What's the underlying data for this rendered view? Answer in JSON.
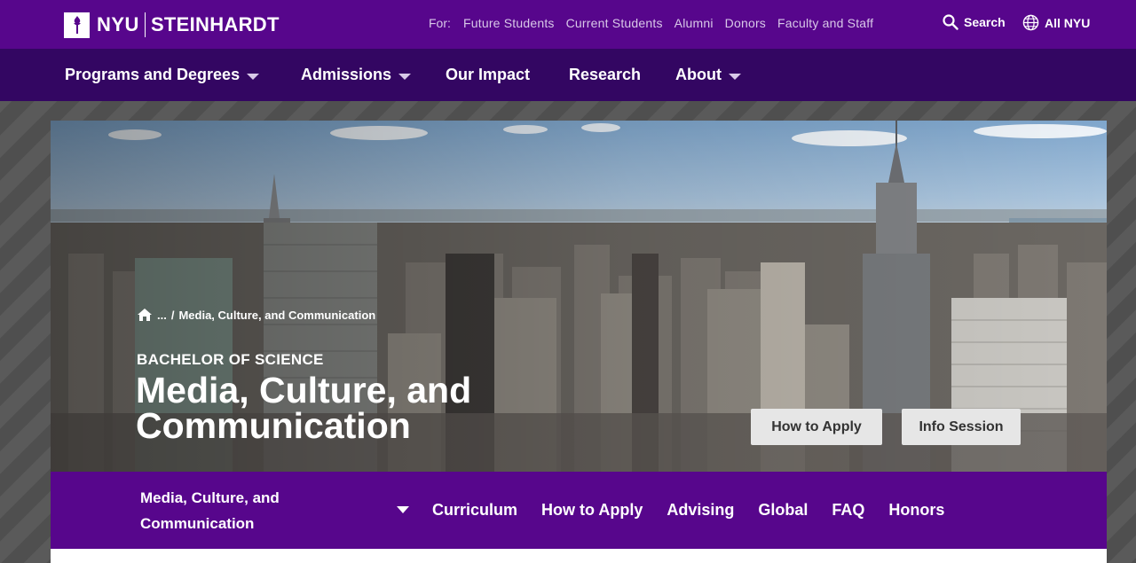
{
  "header": {
    "logo_nyu": "NYU",
    "logo_school": "STEINHARDT",
    "for_label": "For:",
    "utility_links": [
      "Future Students",
      "Current Students",
      "Alumni",
      "Donors",
      "Faculty and Staff"
    ],
    "search_label": "Search",
    "all_nyu_label": "All NYU"
  },
  "nav": {
    "items": [
      {
        "label": "Programs and Degrees",
        "has_dropdown": true
      },
      {
        "label": "Admissions",
        "has_dropdown": true
      },
      {
        "label": "Our Impact",
        "has_dropdown": false
      },
      {
        "label": "Research",
        "has_dropdown": false
      },
      {
        "label": "About",
        "has_dropdown": true
      }
    ]
  },
  "hero": {
    "breadcrumb_ellipsis": "...",
    "breadcrumb_sep": "/",
    "breadcrumb_current": "Media, Culture, and Communication",
    "degree": "BACHELOR OF SCIENCE",
    "title": "Media, Culture, and Communication",
    "buttons": {
      "apply": "How to Apply",
      "info": "Info Session"
    }
  },
  "program_nav": {
    "selected": "Media, Culture, and Communication",
    "links": [
      "Curriculum",
      "How to Apply",
      "Advising",
      "Global",
      "FAQ",
      "Honors"
    ]
  },
  "colors": {
    "brand_purple": "#57068c",
    "nav_purple": "#330662",
    "button_bg": "#e6e6e6"
  }
}
